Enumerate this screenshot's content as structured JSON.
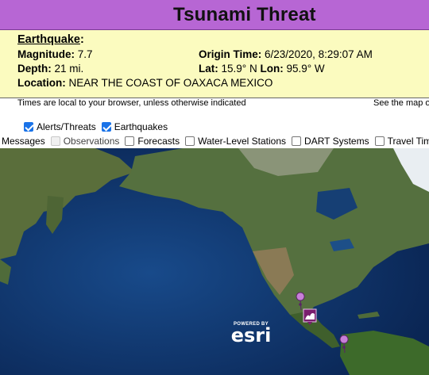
{
  "header": {
    "title": "Tsunami Threat"
  },
  "earthquake": {
    "heading": "Earthquake",
    "heading_suffix": ":",
    "magnitude_label": "Magnitude:",
    "magnitude_value": "7.7",
    "origin_time_label": "Origin Time:",
    "origin_time_value": "6/23/2020, 8:29:07 AM",
    "depth_label": "Depth:",
    "depth_value": "21 mi.",
    "lat_label": "Lat:",
    "lat_value": "15.9° N",
    "lon_label": "Lon:",
    "lon_value": "95.9° W",
    "location_label": "Location:",
    "location_value": "NEAR THE COAST OF OAXACA MEXICO"
  },
  "notes": {
    "times_note": "Times are local to your browser, unless otherwise indicated",
    "map_note": "See the map o"
  },
  "layers": {
    "row1": [
      {
        "label": "Alerts/Threats",
        "checked": true
      },
      {
        "label": "Earthquakes",
        "checked": true
      }
    ],
    "row2": [
      {
        "label": "Messages",
        "checked": false,
        "partial": true
      },
      {
        "label": "Observations",
        "checked": false,
        "disabled": true
      },
      {
        "label": "Forecasts",
        "checked": false
      },
      {
        "label": "Water-Level Stations",
        "checked": false
      },
      {
        "label": "DART Systems",
        "checked": false
      },
      {
        "label": "Travel Time",
        "checked": false
      }
    ]
  },
  "map": {
    "attribution_small": "POWERED BY",
    "attribution_brand": "esri",
    "colors": {
      "ocean": "#0d2f62",
      "land": "#4f6b3a",
      "ice": "#e9eef2",
      "marker": "#c77fd8",
      "threat": "#7a1f6e"
    }
  }
}
